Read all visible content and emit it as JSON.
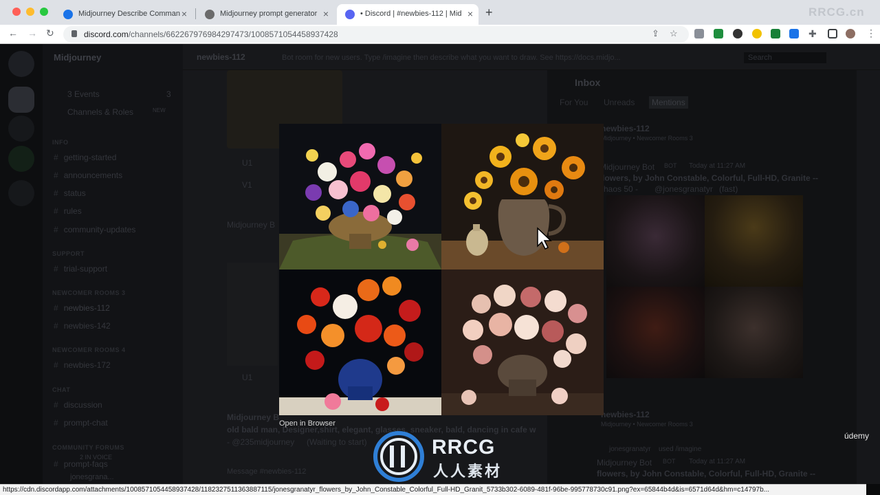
{
  "browser": {
    "tabs": [
      {
        "title": "Midjourney Describe Comman",
        "active": false
      },
      {
        "title": "Midjourney prompt generator",
        "active": false
      },
      {
        "title": "• Discord | #newbies-112 | Mid",
        "active": true
      }
    ],
    "url_host": "discord.com",
    "url_path": "/channels/662267976984297473/1008571054458937428",
    "status_url": "https://cdn.discordapp.com/attachments/1008571054458937428/1182327511363887115/jonesgranatyr_flowers_by_John_Constable_Colorful_Full-HD_Granit_5733b302-6089-481f-96be-995778730c91.png?ex=65844b4d&is=6571d64d&hm=c14797b..."
  },
  "discord": {
    "server_name": "Midjourney",
    "channel_header": "newbies-112",
    "channel_topic": "Bot room for new users. Type /imagine then describe what you want to draw. See https://docs.midjo...",
    "search_placeholder": "Search",
    "sidebar": {
      "events": "3 Events",
      "events_count": "3",
      "channels_roles": "Channels & Roles",
      "new_badge": "NEW",
      "categories": {
        "info": "INFO",
        "support": "SUPPORT",
        "newcomer3": "NEWCOMER ROOMS 3",
        "newcomer4": "NEWCOMER ROOMS 4",
        "chat": "CHAT",
        "forums": "COMMUNITY FORUMS"
      },
      "channels": {
        "getting_started": "getting-started",
        "announcements": "announcements",
        "status": "status",
        "rules": "rules",
        "community_updates": "community-updates",
        "trial_support": "trial-support",
        "newbies_112": "newbies-112",
        "newbies_142": "newbies-142",
        "newbies_172": "newbies-172",
        "discussion": "discussion",
        "prompt_chat": "prompt-chat",
        "prompt_faqs": "prompt-faqs"
      },
      "voice": "2 IN VOICE",
      "user": "jonesgrana..."
    },
    "chat": {
      "upscale_1": "U1",
      "variation_1": "V1",
      "upscale_1b": "U1",
      "bot_name": "Midjourney B",
      "bot_badge": "BOT",
      "line1": "old bald man, Designer,shirt, elegant, glasses, sneaker, bald, dancing in cafe w",
      "line2_mention": "- @235midjourney",
      "line2_status": "(Waiting to start)",
      "message_placeholder": "Message #newbies-112"
    },
    "inbox": {
      "title": "Inbox",
      "tabs": [
        "For You",
        "Unreads",
        "Mentions"
      ],
      "active_tab": "Mentions",
      "channel_1": "newbies-112",
      "sub_1": "Midjourney • Newcomer Rooms 3",
      "bot_name_1": "Midjourney Bot",
      "bot_badge_1": "BOT",
      "time_1": "Today at 11:27 AM",
      "prompt_1a": "flowers, by John Constable, Colorful, Full-HD, Granite --",
      "prompt_1b": "chaos 50 -",
      "mention_1": "@jonesgranatyr",
      "speed_1": "(fast)",
      "channel_2": "newbies-112",
      "sub_2": "Midjourney • Newcomer Rooms 3",
      "used_user": "jonesgranatyr",
      "used_cmd": "used /imagine",
      "bot_name_2": "Midjourney Bot",
      "bot_badge_2": "BOT",
      "time_2": "Today at 11:27 AM",
      "prompt_2": "flowers, by John Constable, Colorful, Full-HD, Granite --"
    }
  },
  "lightbox": {
    "open_in_browser": "Open in Browser",
    "images": [
      "colorful-mixed-bouquet-in-brass-bowl",
      "sunflowers-in-ceramic-jug",
      "red-orange-roses-in-blue-vase",
      "pale-pink-roses-in-silver-vase"
    ]
  },
  "watermark": {
    "top_right": "RRCG.cn",
    "brand": "RRCG",
    "brand_cn": "人人素材",
    "udemy": "údemy"
  }
}
